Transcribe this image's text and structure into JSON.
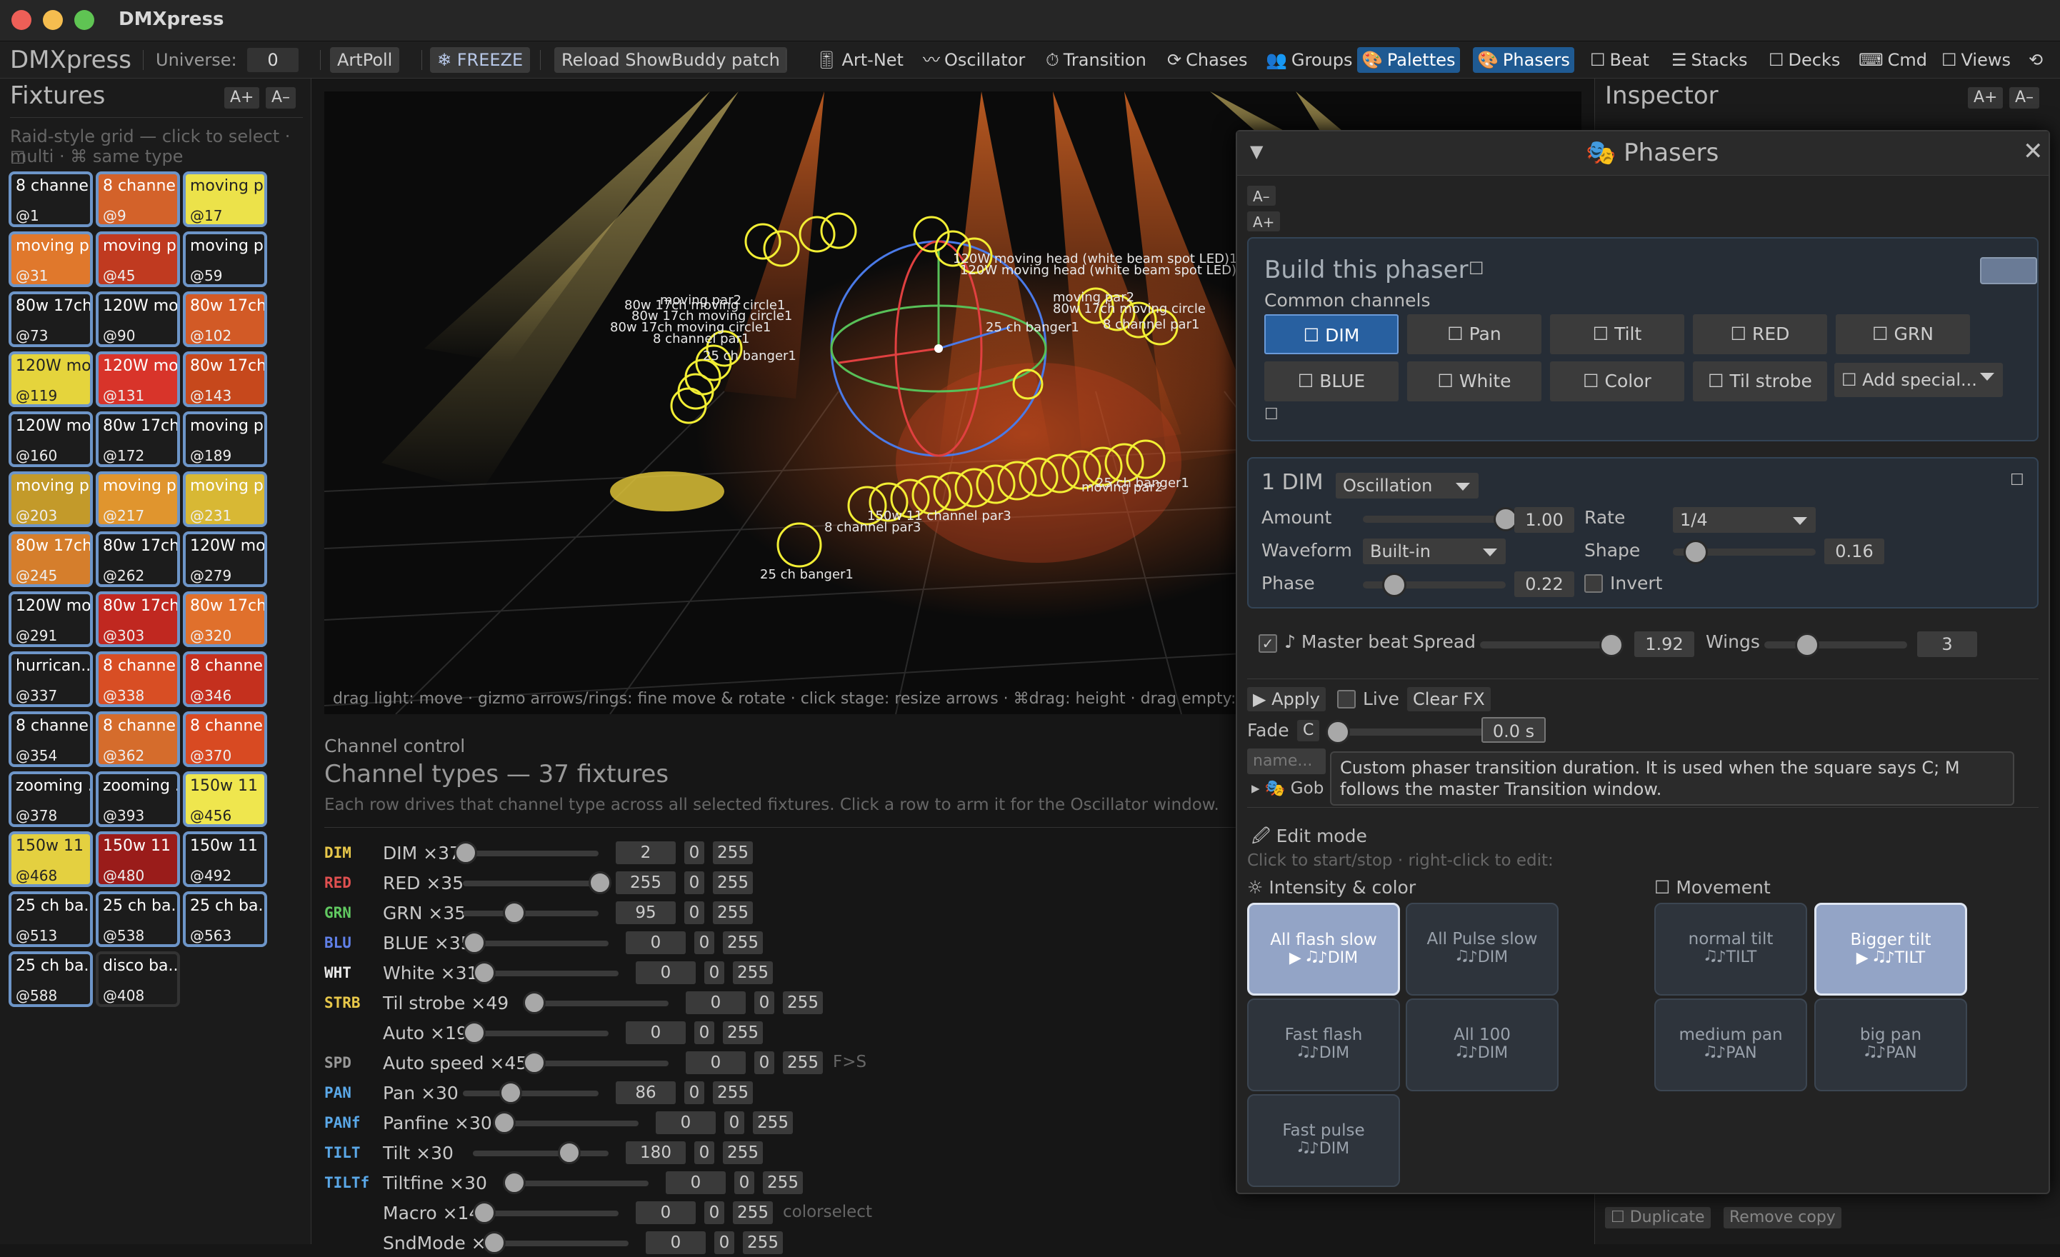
{
  "titlebar": {
    "title": "DMXpress"
  },
  "menubar": {
    "brand": "DMXpress",
    "universe_label": "Universe:",
    "universe_value": "0",
    "artpoll": "ArtPoll",
    "freeze": "❄ FREEZE",
    "reload": "Reload ShowBuddy patch",
    "tabs": [
      "Art-Net",
      "Oscillator",
      "Transition",
      "Chases",
      "Groups",
      "Palettes",
      "Phasers",
      "Beat",
      "Stacks",
      "Decks",
      "Cmd",
      "Views"
    ],
    "tab_icons": [
      "🎚",
      "〰",
      "⏱",
      "⟳",
      "👥",
      "🎨",
      "🎨",
      "☐",
      "☰",
      "☐",
      "⌨",
      "☐"
    ]
  },
  "fixtures": {
    "title": "Fixtures",
    "zoom_in": "A+",
    "zoom_out": "A–",
    "hint_line1": "Raid-style grid — click to select · ☐",
    "hint_line2": "multi · ⌘ same type",
    "tiles": [
      {
        "name": "8 channe...",
        "addr": "@1",
        "color": "#1c1c1c"
      },
      {
        "name": "8 channe...",
        "addr": "@9",
        "color": "#d3622a"
      },
      {
        "name": "moving p...",
        "addr": "@17",
        "color": "#ece24a",
        "y": true
      },
      {
        "name": "moving p...",
        "addr": "@31",
        "color": "#e0782c"
      },
      {
        "name": "moving p...",
        "addr": "@45",
        "color": "#c03a20"
      },
      {
        "name": "moving p...",
        "addr": "@59",
        "color": "#1c1c1c"
      },
      {
        "name": "80w 17ch...",
        "addr": "@73",
        "color": "#1c1c1c"
      },
      {
        "name": "120W mov...",
        "addr": "@90",
        "color": "#1c1c1c"
      },
      {
        "name": "80w 17ch...",
        "addr": "@102",
        "color": "#d25a26"
      },
      {
        "name": "120W mov...",
        "addr": "@119",
        "color": "#e5d43c",
        "y": true
      },
      {
        "name": "120W mov...",
        "addr": "@131",
        "color": "#d8342a"
      },
      {
        "name": "80w 17ch...",
        "addr": "@143",
        "color": "#c6481c"
      },
      {
        "name": "120W mov...",
        "addr": "@160",
        "color": "#1c1c1c"
      },
      {
        "name": "80w 17ch...",
        "addr": "@172",
        "color": "#1c1c1c"
      },
      {
        "name": "moving p...",
        "addr": "@189",
        "color": "#1c1c1c"
      },
      {
        "name": "moving p...",
        "addr": "@203",
        "color": "#c39a2a"
      },
      {
        "name": "moving p...",
        "addr": "@217",
        "color": "#e0952e"
      },
      {
        "name": "moving p...",
        "addr": "@231",
        "color": "#d8b834"
      },
      {
        "name": "80w 17ch...",
        "addr": "@245",
        "color": "#d57e2c"
      },
      {
        "name": "80w 17ch...",
        "addr": "@262",
        "color": "#1c1c1c"
      },
      {
        "name": "120W mov...",
        "addr": "@279",
        "color": "#1c1c1c"
      },
      {
        "name": "120W mov...",
        "addr": "@291",
        "color": "#1c1c1c"
      },
      {
        "name": "80w 17ch...",
        "addr": "@303",
        "color": "#c02820"
      },
      {
        "name": "80w 17ch...",
        "addr": "@320",
        "color": "#e0702c"
      },
      {
        "name": "hurrican...",
        "addr": "@337",
        "color": "#1c1c1c"
      },
      {
        "name": "8 channe...",
        "addr": "@338",
        "color": "#d84e24"
      },
      {
        "name": "8 channe...",
        "addr": "@346",
        "color": "#c4301e"
      },
      {
        "name": "8 channe...",
        "addr": "@354",
        "color": "#1c1c1c"
      },
      {
        "name": "8 channe...",
        "addr": "@362",
        "color": "#d56c2c"
      },
      {
        "name": "8 channe...",
        "addr": "@370",
        "color": "#d84a22"
      },
      {
        "name": "zooming ...",
        "addr": "@378",
        "color": "#1c1c1c"
      },
      {
        "name": "zooming ...",
        "addr": "@393",
        "color": "#1c1c1c"
      },
      {
        "name": "150w 11 ...",
        "addr": "@456",
        "color": "#efe64e",
        "y": true
      },
      {
        "name": "150w 11 ...",
        "addr": "@468",
        "color": "#e4d040",
        "y": true
      },
      {
        "name": "150w 11 ...",
        "addr": "@480",
        "color": "#9a1c1a"
      },
      {
        "name": "150w 11 ...",
        "addr": "@492",
        "color": "#1c1c1c"
      },
      {
        "name": "25 ch ba...",
        "addr": "@513",
        "color": "#1c1c1c"
      },
      {
        "name": "25 ch ba...",
        "addr": "@538",
        "color": "#1c1c1c"
      },
      {
        "name": "25 ch ba...",
        "addr": "@563",
        "color": "#1c1c1c"
      },
      {
        "name": "25 ch ba...",
        "addr": "@588",
        "color": "#1c1c1c"
      },
      {
        "name": "disco ba...",
        "addr": "@408",
        "color": "#1c1c1c",
        "nosel": true
      }
    ]
  },
  "viewport": {
    "hint": "drag light: move · gizmo arrows/rings: fine move & rotate · click stage: resize arrows · ⌘drag: height · drag empty: pan · ☐drag empty: r",
    "labels": [
      "120W moving head (white beam spot LED)1",
      "120W moving head (white beam spot LED)1",
      "moving par2",
      "80w 17ch moving circle1",
      "80w 17ch moving circle1",
      "80w 17ch moving circle1",
      "8 channel par1",
      "25 ch banger1",
      "25 ch banger1",
      "moving par2",
      "80w 17ch moving circle",
      "8 channel par1",
      "25 ch banger1",
      "150w 11 channel par3",
      "8 channel par3",
      "25 ch banger1",
      "moving par2"
    ]
  },
  "channel_control": {
    "section": "Channel control",
    "title": "Channel types — 37 fixtures",
    "hint": "Each row drives that channel type across all selected fixtures. Click a row to arm it for the Oscillator window.",
    "rows": [
      {
        "tag": "DIM",
        "tagcolor": "#e8c84a",
        "name": "DIM ×37",
        "value": "2",
        "min": "0",
        "max": "255",
        "level": 0.01
      },
      {
        "tag": "RED",
        "tagcolor": "#e05050",
        "name": "RED ×35",
        "value": "255",
        "min": "0",
        "max": "255",
        "level": 1.0
      },
      {
        "tag": "GRN",
        "tagcolor": "#60c860",
        "name": "GRN ×35",
        "value": "95",
        "min": "0",
        "max": "255",
        "level": 0.37
      },
      {
        "tag": "BLU",
        "tagcolor": "#6080e8",
        "name": "BLUE ×35",
        "value": "0",
        "min": "0",
        "max": "255",
        "level": 0
      },
      {
        "tag": "WHT",
        "tagcolor": "#e8e8e8",
        "name": "White ×31",
        "value": "0",
        "min": "0",
        "max": "255",
        "level": 0
      },
      {
        "tag": "STRB",
        "tagcolor": "#e8c84a",
        "name": "Til strobe ×49",
        "value": "0",
        "min": "0",
        "max": "255",
        "level": 0
      },
      {
        "tag": "",
        "tagcolor": "#999",
        "name": "Auto ×19",
        "value": "0",
        "min": "0",
        "max": "255",
        "level": 0
      },
      {
        "tag": "SPD",
        "tagcolor": "#999",
        "name": "Auto speed ×45",
        "value": "0",
        "min": "0",
        "max": "255",
        "level": 0,
        "extra": "F>S"
      },
      {
        "tag": "PAN",
        "tagcolor": "#5aa8e8",
        "name": "Pan ×30",
        "value": "86",
        "min": "0",
        "max": "255",
        "level": 0.34
      },
      {
        "tag": "PANf",
        "tagcolor": "#5aa8e8",
        "name": "Panfine ×30",
        "value": "0",
        "min": "0",
        "max": "255",
        "level": 0
      },
      {
        "tag": "TILT",
        "tagcolor": "#5aa8e8",
        "name": "Tilt ×30",
        "value": "180",
        "min": "0",
        "max": "255",
        "level": 0.7
      },
      {
        "tag": "TILTf",
        "tagcolor": "#5aa8e8",
        "name": "Tiltfine ×30",
        "value": "0",
        "min": "0",
        "max": "255",
        "level": 0
      },
      {
        "tag": "",
        "tagcolor": "#999",
        "name": "Macro ×14",
        "value": "0",
        "min": "0",
        "max": "255",
        "level": 0,
        "extra": "colorselect"
      },
      {
        "tag": "",
        "tagcolor": "#999",
        "name": "SndMode ×8",
        "value": "0",
        "min": "0",
        "max": "255",
        "level": 0
      }
    ]
  },
  "inspector": {
    "title": "Inspector",
    "zoom_in": "A+",
    "zoom_out": "A–",
    "duplicate": "☐ Duplicate",
    "remove_copy": "Remove copy"
  },
  "phasers": {
    "title": "Phasers",
    "font_down": "A–",
    "font_up": "A+",
    "build_title": "Build this phaser",
    "common_channels": "Common channels",
    "channels": [
      "☐ DIM",
      "☐ Pan",
      "☐ Tilt",
      "☐ RED",
      "☐ GRN",
      "☐ BLUE",
      "☐ White",
      "☐ Color",
      "☐ Til strobe"
    ],
    "add_special": "☐ Add special...",
    "layer": {
      "index": "1",
      "channel": "DIM",
      "mode": "Oscillation",
      "amount_label": "Amount",
      "amount": "1.00",
      "amount_level": 1.0,
      "rate_label": "Rate",
      "rate": "1/4",
      "waveform_label": "Waveform",
      "waveform": "Built-in",
      "shape_label": "Shape",
      "shape": "0.16",
      "shape_level": 0.16,
      "phase_label": "Phase",
      "phase": "0.22",
      "phase_level": 0.22,
      "invert_label": "Invert"
    },
    "master_beat": "♪ Master beat",
    "spread_label": "Spread",
    "spread": "1.92",
    "spread_level": 0.92,
    "wings_label": "Wings",
    "wings": "3",
    "wings_level": 0.3,
    "apply": "▶ Apply",
    "live": "Live",
    "clear_fx": "Clear FX",
    "fade_label": "Fade",
    "fade_mode": "C",
    "fade_value": "0.0 s",
    "name_placeholder": "name...",
    "gobo_label": "▸ 🎭 Gob",
    "tooltip": "Custom phaser transition duration. It is used when the square says C; M follows the master Transition window.",
    "edit_mode": "🖉 Edit mode",
    "edit_hint": "Click to start/stop · right-click to edit:",
    "intensity_header": "☼ Intensity & color",
    "movement_header": "☐ Movement",
    "presets": [
      {
        "t": "All flash slow",
        "s": "▶ 🎝♪DIM",
        "on": true
      },
      {
        "t": "All Pulse slow",
        "s": "🎝♪DIM"
      },
      {
        "t": "Fast flash",
        "s": "🎝♪DIM"
      },
      {
        "t": "All 100",
        "s": "🎝♪DIM"
      },
      {
        "t": "Fast pulse",
        "s": "🎝♪DIM"
      }
    ],
    "movement_presets": [
      {
        "t": "normal tilt",
        "s": "🎝♪TILT"
      },
      {
        "t": "Bigger tilt",
        "s": "▶ 🎝♪TILT",
        "on": true
      },
      {
        "t": "medium pan",
        "s": "🎝♪PAN"
      },
      {
        "t": "big pan",
        "s": "🎝♪PAN"
      }
    ]
  }
}
